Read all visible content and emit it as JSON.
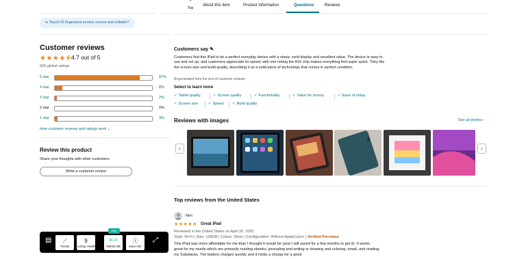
{
  "nav": {
    "top_label": "Top",
    "tabs": [
      "About this item",
      "Product information",
      "Questions",
      "Reviews"
    ]
  },
  "question_chip": "Is Touch ID fingerprint sensor secure and reliable?",
  "customer_reviews": {
    "title": "Customer reviews",
    "stars": "★★★★⯪",
    "average": "4.7 out of 5",
    "global_ratings": "929 global ratings",
    "breakdown": [
      {
        "label": "5 star",
        "pct": "87%",
        "value": 87
      },
      {
        "label": "4 star",
        "pct": "8%",
        "value": 8
      },
      {
        "label": "3 star",
        "pct": "2%",
        "value": 2
      },
      {
        "label": "2 star",
        "pct": "0%",
        "value": 0
      },
      {
        "label": "1 star",
        "pct": "3%",
        "value": 3
      }
    ],
    "how_link": "How customer reviews and ratings work"
  },
  "review_product": {
    "title": "Review this product",
    "subtitle": "Share your thoughts with other customers",
    "button": "Write a customer review"
  },
  "customers_say": {
    "title": "Customers say",
    "text": "Customers find this iPad to be a perfect everyday device with a sharp, vivid display and excellent value. The device is easy to use and set up, and customers appreciate its speed, with one noting the A16 chip makes everything feel super quick. They like the screen size and build quality, describing it as a solid piece of technology that comes in perfect condition.",
    "ai_note": "AI-generated from the text of customer reviews",
    "select_title": "Select to learn more",
    "aspects": [
      "Tablet quality",
      "Screen quality",
      "Functionality",
      "Value for money",
      "Ease of setup",
      "Screen size",
      "Speed",
      "Build quality"
    ]
  },
  "reviews_with_images": {
    "title": "Reviews with images",
    "see_all": "See all photos ›"
  },
  "top_reviews": {
    "title": "Top reviews from the United States",
    "reviewer": "Nim",
    "stars": "★★★★★",
    "review_title": "Great iPad",
    "date": "Reviewed in the United States on April 20, 2025",
    "style": "Style: Wi-Fi",
    "size": "Size: 128GB",
    "colour": "Colour: Silver",
    "configuration": "Configuration: Without AppleCare+",
    "verified": "Verified Purchase",
    "body": "This iPad was more affordable for me than I thought it would be (and I still saved for a few months to get it). It works great for my needs which are primarily reading ebooks, journaling and writing or drawing and coloring, email, and reading my Substacks. The battery charges quickly and it holds a charge for a good"
  },
  "toolbar": {
    "badge": "High",
    "trends": "Trends",
    "listing_health_value": "9",
    "listing_health": "Listing Health",
    "market_value": "$6.20",
    "market": "Market OB",
    "more_info": "More Info"
  },
  "colors": {
    "accent_link": "#007185",
    "star": "#f08804",
    "bar_fill": "#de7921",
    "verified": "#c45500"
  }
}
